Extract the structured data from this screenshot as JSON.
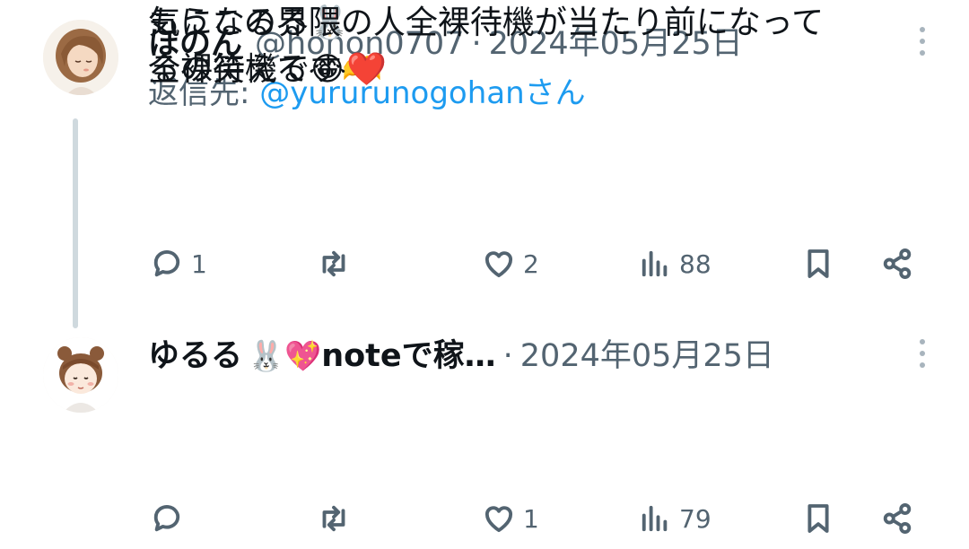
{
  "tweets": [
    {
      "name": "ほのん",
      "handle": "@honon0707",
      "separator": "·",
      "date": "2024年05月25日",
      "reply_prefix": "返信先: ",
      "reply_mention": "@yururunogohan",
      "reply_suffix": "さん",
      "lines": [
        "気になるる🐰",
        "全裸待機です🫶"
      ],
      "replies": "1",
      "retweets": "",
      "likes": "2",
      "views": "88"
    },
    {
      "name": "ゆるる",
      "name_emoji": "🐰💖",
      "name_suffix": "noteで稼…",
      "separator": "·",
      "date": "2024年05月25日",
      "lines": [
        "もうこの界隈の人全裸待機が当たり前になって",
        "るの笑える😂❤️"
      ],
      "replies": "",
      "retweets": "",
      "likes": "1",
      "views": "79"
    }
  ],
  "icons": [
    "reply-icon",
    "retweet-icon",
    "like-icon",
    "views-icon",
    "bookmark-icon",
    "share-icon",
    "more-icon"
  ],
  "colors": {
    "text": "#0f1419",
    "secondary": "#536471",
    "link": "#1d9bf0",
    "thread_line": "#cfd9de"
  }
}
